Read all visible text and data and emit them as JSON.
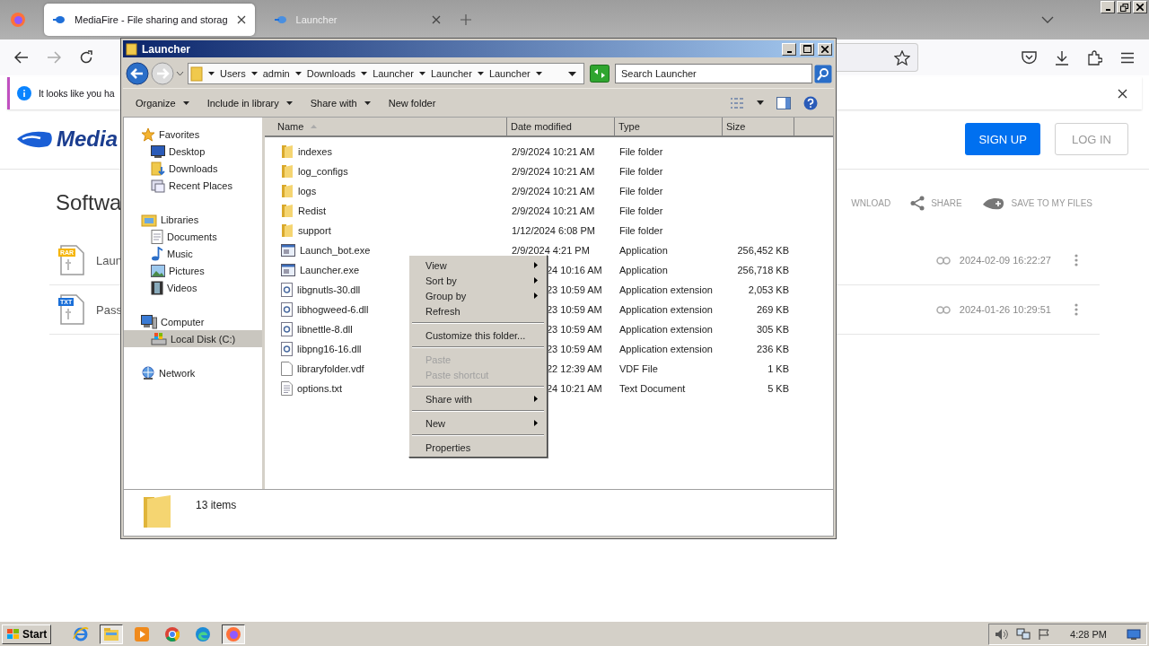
{
  "browser": {
    "tabs": [
      {
        "title": "MediaFire - File sharing and storag",
        "selected": true
      },
      {
        "title": "Launcher",
        "selected": false
      }
    ],
    "notification": "It looks like you ha",
    "logo": "Media",
    "auth_buttons": [
      {
        "label": "SIGN UP",
        "kind": "primary"
      },
      {
        "label": "LOG IN",
        "kind": "outline"
      }
    ],
    "heading": "Softwa",
    "actions": [
      {
        "label": "WNLOAD",
        "kind": "download"
      },
      {
        "label": "SHARE",
        "kind": "share"
      },
      {
        "label": "SAVE TO MY FILES",
        "kind": "save"
      }
    ],
    "files": [
      {
        "badge": "RAR",
        "name": "Laun",
        "date": "2024-02-09 16:22:27"
      },
      {
        "badge": "TXT",
        "name": "Pass",
        "date": "2024-01-26 10:29:51"
      }
    ]
  },
  "explorer": {
    "title": "Launcher",
    "breadcrumbs": [
      "Users",
      "admin",
      "Downloads",
      "Launcher",
      "Launcher",
      "Launcher"
    ],
    "search": {
      "placeholder": "Search Launcher"
    },
    "toolbar": [
      {
        "label": "Organize",
        "dropdown": true
      },
      {
        "label": "Include in library",
        "dropdown": true
      },
      {
        "label": "Share with",
        "dropdown": true
      },
      {
        "label": "New folder",
        "dropdown": false
      }
    ],
    "nav": [
      {
        "label": "Favorites",
        "kind": "star",
        "selected": false,
        "children": [
          {
            "label": "Desktop",
            "kind": "desktop",
            "selected": false
          },
          {
            "label": "Downloads",
            "kind": "downloads",
            "selected": false
          },
          {
            "label": "Recent Places",
            "kind": "recent",
            "selected": false
          }
        ]
      },
      {
        "label": "Libraries",
        "kind": "libraries",
        "selected": false,
        "children": [
          {
            "label": "Documents",
            "kind": "documents",
            "selected": false
          },
          {
            "label": "Music",
            "kind": "music",
            "selected": false
          },
          {
            "label": "Pictures",
            "kind": "pictures",
            "selected": false
          },
          {
            "label": "Videos",
            "kind": "videos",
            "selected": false
          }
        ]
      },
      {
        "label": "Computer",
        "kind": "computer",
        "selected": false,
        "children": [
          {
            "label": "Local Disk (C:)",
            "kind": "disk",
            "selected": true
          }
        ]
      },
      {
        "label": "Network",
        "kind": "network",
        "selected": false
      }
    ],
    "columns": [
      {
        "label": "Name",
        "sorted": true
      },
      {
        "label": "Date modified",
        "sorted": false
      },
      {
        "label": "Type",
        "sorted": false
      },
      {
        "label": "Size",
        "sorted": false
      }
    ],
    "rows": [
      {
        "kind": "folder",
        "name": "indexes",
        "date": "2/9/2024 10:21 AM",
        "covered": false,
        "type": "File folder"
      },
      {
        "kind": "folder",
        "name": "log_configs",
        "date": "2/9/2024 10:21 AM",
        "covered": false,
        "type": "File folder"
      },
      {
        "kind": "folder",
        "name": "logs",
        "date": "2/9/2024 10:21 AM",
        "covered": false,
        "type": "File folder"
      },
      {
        "kind": "folder",
        "name": "Redist",
        "date": "2/9/2024 10:21 AM",
        "covered": false,
        "type": "File folder"
      },
      {
        "kind": "folder",
        "name": "support",
        "date": "1/12/2024 6:08 PM",
        "covered": false,
        "type": "File folder"
      },
      {
        "kind": "app",
        "name": "Launch_bot.exe",
        "date": "2/9/2024 4:21 PM",
        "covered": false,
        "type": "Application",
        "size": "256,452 KB"
      },
      {
        "kind": "app",
        "name": "Launcher.exe",
        "date": "24 10:16 AM",
        "covered": true,
        "type": "Application",
        "size": "256,718 KB"
      },
      {
        "kind": "dll",
        "name": "libgnutls-30.dll",
        "date": "23 10:59 AM",
        "covered": true,
        "type": "Application extension",
        "size": "2,053 KB"
      },
      {
        "kind": "dll",
        "name": "libhogweed-6.dll",
        "date": "23 10:59 AM",
        "covered": true,
        "type": "Application extension",
        "size": "269 KB"
      },
      {
        "kind": "dll",
        "name": "libnettle-8.dll",
        "date": "23 10:59 AM",
        "covered": true,
        "type": "Application extension",
        "size": "305 KB"
      },
      {
        "kind": "dll",
        "name": "libpng16-16.dll",
        "date": "23 10:59 AM",
        "covered": true,
        "type": "Application extension",
        "size": "236 KB"
      },
      {
        "kind": "blank",
        "name": "libraryfolder.vdf",
        "date": "22 12:39 AM",
        "covered": true,
        "type": "VDF File",
        "size": "1 KB"
      },
      {
        "kind": "text",
        "name": "options.txt",
        "date": "24 10:21 AM",
        "covered": true,
        "type": "Text Document",
        "size": "5 KB"
      }
    ],
    "status": "13 items"
  },
  "context_menu": [
    {
      "kind": "item",
      "label": "View",
      "submenu": true,
      "disabled": false
    },
    {
      "kind": "item",
      "label": "Sort by",
      "submenu": true,
      "disabled": false
    },
    {
      "kind": "item",
      "label": "Group by",
      "submenu": true,
      "disabled": false
    },
    {
      "kind": "item",
      "label": "Refresh",
      "submenu": false,
      "disabled": false
    },
    {
      "kind": "separator"
    },
    {
      "kind": "item",
      "label": "Customize this folder...",
      "submenu": false,
      "disabled": false
    },
    {
      "kind": "separator"
    },
    {
      "kind": "item",
      "label": "Paste",
      "submenu": false,
      "disabled": true
    },
    {
      "kind": "item",
      "label": "Paste shortcut",
      "submenu": false,
      "disabled": true
    },
    {
      "kind": "separator"
    },
    {
      "kind": "item",
      "label": "Share with",
      "submenu": true,
      "disabled": false
    },
    {
      "kind": "separator"
    },
    {
      "kind": "item",
      "label": "New",
      "submenu": true,
      "disabled": false
    },
    {
      "kind": "separator"
    },
    {
      "kind": "item",
      "label": "Properties",
      "submenu": false,
      "disabled": false
    }
  ],
  "taskbar": {
    "start": "Start",
    "apps": [
      {
        "kind": "ie",
        "pressed": false
      },
      {
        "kind": "explorer",
        "pressed": true
      },
      {
        "kind": "media",
        "pressed": false
      },
      {
        "kind": "chrome",
        "pressed": false
      },
      {
        "kind": "edge",
        "pressed": false
      },
      {
        "kind": "firefox",
        "pressed": true
      }
    ],
    "clock": "4:28 PM"
  }
}
